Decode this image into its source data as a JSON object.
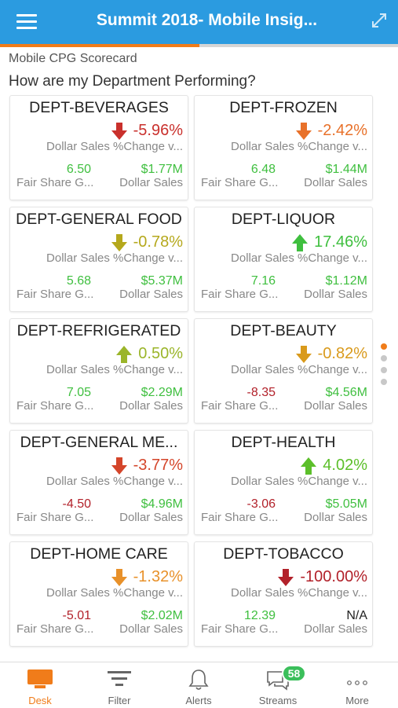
{
  "header": {
    "title": "Summit 2018- Mobile Insig..."
  },
  "progress": {
    "fraction": 0.5
  },
  "page": {
    "subtitle": "Mobile CPG Scorecard",
    "question": "How are my Department Performing?"
  },
  "colors": {
    "red": "#c9302c",
    "orange": "#e8912a",
    "olive": "#b5a81c",
    "green": "#3fbf3f",
    "darkred": "#b2212a",
    "accent": "#f07c1a"
  },
  "tiles": [
    {
      "dept": "DEPT-BEVERAGES",
      "change": "-5.96%",
      "change_color": "#c9302c",
      "arrow": "down",
      "change_label": "Dollar Sales %Change v...",
      "fs_value": "6.50",
      "fs_color": "#3fbf3f",
      "fs_label": "Fair Share G...",
      "ds_value": "$1.77M",
      "ds_color": "#3fbf3f",
      "ds_label": "Dollar Sales"
    },
    {
      "dept": "DEPT-FROZEN",
      "change": "-2.42%",
      "change_color": "#e8712a",
      "arrow": "down",
      "change_label": "Dollar Sales %Change v...",
      "fs_value": "6.48",
      "fs_color": "#3fbf3f",
      "fs_label": "Fair Share G...",
      "ds_value": "$1.44M",
      "ds_color": "#3fbf3f",
      "ds_label": "Dollar Sales"
    },
    {
      "dept": "DEPT-GENERAL FOOD",
      "change": "-0.78%",
      "change_color": "#b5a81c",
      "arrow": "down",
      "change_label": "Dollar Sales %Change v...",
      "fs_value": "5.68",
      "fs_color": "#3fbf3f",
      "fs_label": "Fair Share G...",
      "ds_value": "$5.37M",
      "ds_color": "#3fbf3f",
      "ds_label": "Dollar Sales"
    },
    {
      "dept": "DEPT-LIQUOR",
      "change": "17.46%",
      "change_color": "#3fbf3f",
      "arrow": "up",
      "change_label": "Dollar Sales %Change v...",
      "fs_value": "7.16",
      "fs_color": "#3fbf3f",
      "fs_label": "Fair Share G...",
      "ds_value": "$1.12M",
      "ds_color": "#3fbf3f",
      "ds_label": "Dollar Sales"
    },
    {
      "dept": "DEPT-REFRIGERATED",
      "change": "0.50%",
      "change_color": "#9bb52a",
      "arrow": "up",
      "change_label": "Dollar Sales %Change v...",
      "fs_value": "7.05",
      "fs_color": "#3fbf3f",
      "fs_label": "Fair Share G...",
      "ds_value": "$2.29M",
      "ds_color": "#3fbf3f",
      "ds_label": "Dollar Sales"
    },
    {
      "dept": "DEPT-BEAUTY",
      "change": "-0.82%",
      "change_color": "#d99a1c",
      "arrow": "down",
      "change_label": "Dollar Sales %Change v...",
      "fs_value": "-8.35",
      "fs_color": "#b2212a",
      "fs_label": "Fair Share G...",
      "ds_value": "$4.56M",
      "ds_color": "#3fbf3f",
      "ds_label": "Dollar Sales"
    },
    {
      "dept": "DEPT-GENERAL ME...",
      "change": "-3.77%",
      "change_color": "#d4452a",
      "arrow": "down",
      "change_label": "Dollar Sales %Change v...",
      "fs_value": "-4.50",
      "fs_color": "#b2212a",
      "fs_label": "Fair Share G...",
      "ds_value": "$4.96M",
      "ds_color": "#3fbf3f",
      "ds_label": "Dollar Sales"
    },
    {
      "dept": "DEPT-HEALTH",
      "change": "4.02%",
      "change_color": "#5cbf2a",
      "arrow": "up",
      "change_label": "Dollar Sales %Change v...",
      "fs_value": "-3.06",
      "fs_color": "#b2212a",
      "fs_label": "Fair Share G...",
      "ds_value": "$5.05M",
      "ds_color": "#3fbf3f",
      "ds_label": "Dollar Sales"
    },
    {
      "dept": "DEPT-HOME CARE",
      "change": "-1.32%",
      "change_color": "#e8912a",
      "arrow": "down",
      "change_label": "Dollar Sales %Change v...",
      "fs_value": "-5.01",
      "fs_color": "#b2212a",
      "fs_label": "Fair Share G...",
      "ds_value": "$2.02M",
      "ds_color": "#3fbf3f",
      "ds_label": "Dollar Sales"
    },
    {
      "dept": "DEPT-TOBACCO",
      "change": "-100.00%",
      "change_color": "#b2212a",
      "arrow": "down",
      "change_label": "Dollar Sales %Change v...",
      "fs_value": "12.39",
      "fs_color": "#3fbf3f",
      "fs_label": "Fair Share G...",
      "ds_value": "N/A",
      "ds_color": "#222222",
      "ds_label": "Dollar Sales"
    }
  ],
  "pager": {
    "count": 4,
    "active": 0
  },
  "tabs": [
    {
      "label": "Desk",
      "icon": "desk-icon",
      "active": true
    },
    {
      "label": "Filter",
      "icon": "filter-icon",
      "active": false
    },
    {
      "label": "Alerts",
      "icon": "bell-icon",
      "active": false
    },
    {
      "label": "Streams",
      "icon": "chat-icon",
      "active": false,
      "badge": "58"
    },
    {
      "label": "More",
      "icon": "more-icon",
      "active": false
    }
  ]
}
